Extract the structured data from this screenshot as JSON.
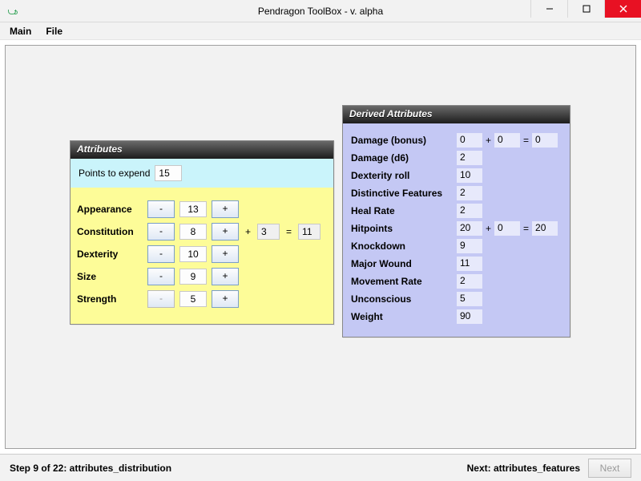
{
  "window": {
    "title": "Pendragon ToolBox - v. alpha",
    "min": "—",
    "max": "▢",
    "close": "✕"
  },
  "menu": {
    "main": "Main",
    "file": "File"
  },
  "attributes": {
    "header": "Attributes",
    "points_label": "Points to expend",
    "points_value": "15",
    "rows": {
      "appearance": {
        "label": "Appearance",
        "value": "13"
      },
      "constitution": {
        "label": "Constitution",
        "value": "8",
        "bonus": "3",
        "total": "11"
      },
      "dexterity": {
        "label": "Dexterity",
        "value": "10"
      },
      "size": {
        "label": "Size",
        "value": "9"
      },
      "strength": {
        "label": "Strength",
        "value": "5"
      }
    },
    "plus": "+",
    "minus": "-",
    "eq": "="
  },
  "derived": {
    "header": "Derived Attributes",
    "damage_bonus": {
      "label": "Damage (bonus)",
      "a": "0",
      "b": "0",
      "total": "0"
    },
    "damage_d6": {
      "label": "Damage (d6)",
      "value": "2"
    },
    "dex_roll": {
      "label": "Dexterity roll",
      "value": "10"
    },
    "dist_feat": {
      "label": "Distinctive Features",
      "value": "2"
    },
    "heal_rate": {
      "label": "Heal Rate",
      "value": "2"
    },
    "hitpoints": {
      "label": "Hitpoints",
      "a": "20",
      "b": "0",
      "total": "20"
    },
    "knockdown": {
      "label": "Knockdown",
      "value": "9"
    },
    "major_wound": {
      "label": "Major Wound",
      "value": "11"
    },
    "move_rate": {
      "label": "Movement Rate",
      "value": "2"
    },
    "unconscious": {
      "label": "Unconscious",
      "value": "5"
    },
    "weight": {
      "label": "Weight",
      "value": "90"
    },
    "plus": "+",
    "eq": "="
  },
  "footer": {
    "step": "Step 9 of 22: attributes_distribution",
    "next_label": "Next: attributes_features",
    "next_btn": "Next"
  }
}
